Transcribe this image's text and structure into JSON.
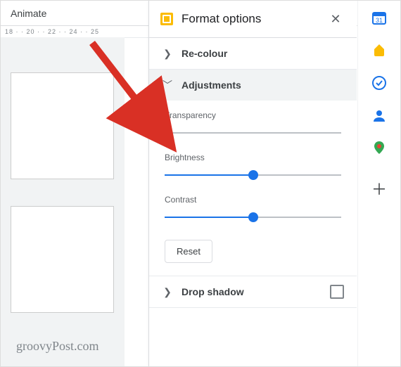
{
  "toolbar": {
    "animate_label": "Animate",
    "ruler_ticks": "18 ·  · 20 ·  · 22 ·  · 24 ·  · 25"
  },
  "panel": {
    "title": "Format options",
    "sections": {
      "recolour": {
        "label": "Re-colour"
      },
      "adjustments": {
        "label": "Adjustments",
        "transparency": {
          "label": "Transparency",
          "value_pct": 0
        },
        "brightness": {
          "label": "Brightness",
          "value_pct": 50
        },
        "contrast": {
          "label": "Contrast",
          "value_pct": 50
        },
        "reset_label": "Reset"
      },
      "dropshadow": {
        "label": "Drop shadow"
      }
    }
  },
  "watermark": "groovyPost.com"
}
